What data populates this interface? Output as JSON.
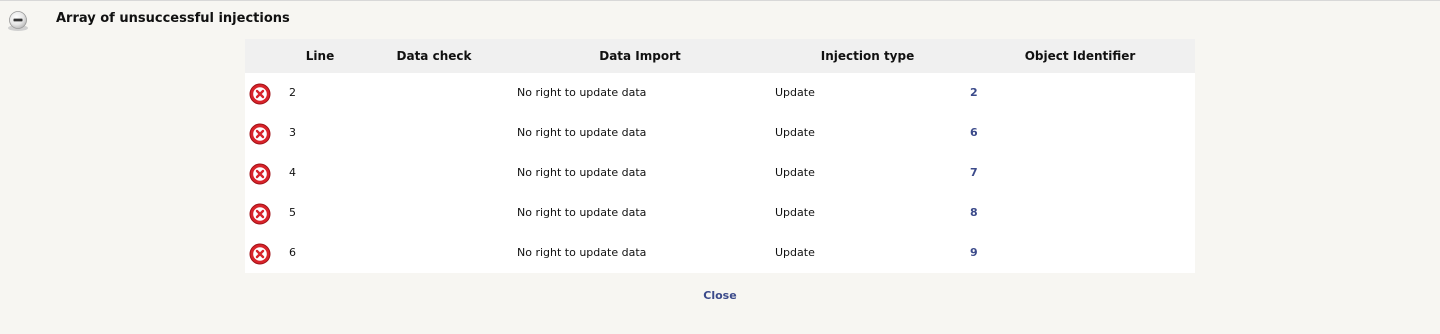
{
  "section": {
    "title": "Array of unsuccessful injections",
    "collapse_icon": "minus-circle-icon"
  },
  "table": {
    "headers": {
      "line": "Line",
      "data_check": "Data check",
      "data_import": "Data Import",
      "injection_type": "Injection type",
      "object_identifier": "Object Identifier"
    },
    "rows": [
      {
        "status_icon": "error-x-icon",
        "line": "2",
        "data_check": "",
        "data_import": "No right to update data",
        "injection_type": "Update",
        "object_identifier": "2"
      },
      {
        "status_icon": "error-x-icon",
        "line": "3",
        "data_check": "",
        "data_import": "No right to update data",
        "injection_type": "Update",
        "object_identifier": "6"
      },
      {
        "status_icon": "error-x-icon",
        "line": "4",
        "data_check": "",
        "data_import": "No right to update data",
        "injection_type": "Update",
        "object_identifier": "7"
      },
      {
        "status_icon": "error-x-icon",
        "line": "5",
        "data_check": "",
        "data_import": "No right to update data",
        "injection_type": "Update",
        "object_identifier": "8"
      },
      {
        "status_icon": "error-x-icon",
        "line": "6",
        "data_check": "",
        "data_import": "No right to update data",
        "injection_type": "Update",
        "object_identifier": "9"
      }
    ]
  },
  "footer": {
    "close_label": "Close"
  },
  "colors": {
    "background": "#f7f6f2",
    "header_row": "#f0f0f0",
    "link": "#3b4a8a",
    "error": "#d8232a"
  }
}
